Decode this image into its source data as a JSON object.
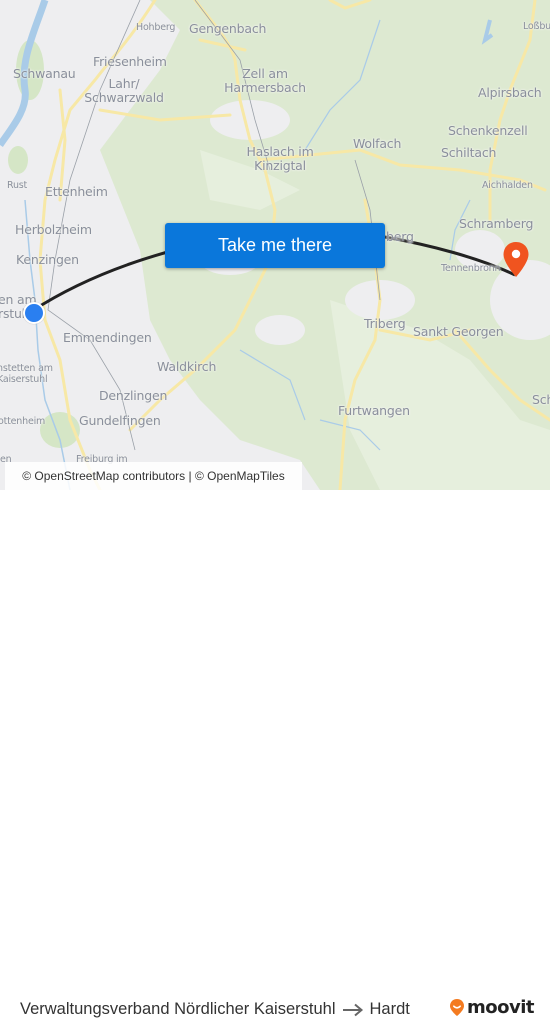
{
  "map": {
    "labels": [
      {
        "text": "Hohberg",
        "size": "small"
      },
      {
        "text": "Gengenbach",
        "size": "big"
      },
      {
        "text": "Loßbu",
        "size": "small"
      },
      {
        "text": "Schwanau",
        "size": "big"
      },
      {
        "text": "Friesenheim",
        "size": "big"
      },
      {
        "text": "Lahr/\nSchwarzwald",
        "size": "big"
      },
      {
        "text": "Zell am\nHarmersbach",
        "size": "big"
      },
      {
        "text": "Alpirsbach",
        "size": "big"
      },
      {
        "text": "Schenkenzell",
        "size": "big"
      },
      {
        "text": "Wolfach",
        "size": "big"
      },
      {
        "text": "Haslach im\nKinzigtal",
        "size": "big"
      },
      {
        "text": "Schiltach",
        "size": "big"
      },
      {
        "text": "Rust",
        "size": "small"
      },
      {
        "text": "Ettenheim",
        "size": "big"
      },
      {
        "text": "Aichhalden",
        "size": "small"
      },
      {
        "text": "Herbolzheim",
        "size": "big"
      },
      {
        "text": "Schramberg",
        "size": "big"
      },
      {
        "text": "Kenzingen",
        "size": "big"
      },
      {
        "text": "Tennenbronn",
        "size": "small"
      },
      {
        "text": "berg",
        "size": "big"
      },
      {
        "text": "en am\nrstuhl",
        "size": "big"
      },
      {
        "text": "Emmendingen",
        "size": "big"
      },
      {
        "text": "Triberg",
        "size": "big"
      },
      {
        "text": "Sankt Georgen",
        "size": "big"
      },
      {
        "text": "Waldkirch",
        "size": "big"
      },
      {
        "text": "hstetten am\nKaiserstuhl",
        "size": "small"
      },
      {
        "text": "Denzlingen",
        "size": "big"
      },
      {
        "text": "Sch",
        "size": "big"
      },
      {
        "text": "ottenheim",
        "size": "small"
      },
      {
        "text": "Gundelfingen",
        "size": "big"
      },
      {
        "text": "Furtwangen",
        "size": "big"
      },
      {
        "text": "Freiburg im",
        "size": "small"
      },
      {
        "text": "en",
        "size": "small"
      }
    ],
    "cta_label": "Take me there",
    "origin_marker": "origin-dot-icon",
    "destination_marker": "destination-pin-icon",
    "colors": {
      "route": "#222222",
      "cta": "#0a77db",
      "origin": "#2a7ff0",
      "destination": "#f0541f"
    },
    "attribution": "© OpenStreetMap contributors | © OpenMapTiles"
  },
  "footer": {
    "origin": "Verwaltungsverband Nördlicher Kaiserstuhl",
    "arrow_icon": "arrow-right-icon",
    "destination": "Hardt",
    "brand": "moovit",
    "brand_icon": "moovit-pin-icon",
    "brand_color": "#f47b20"
  }
}
